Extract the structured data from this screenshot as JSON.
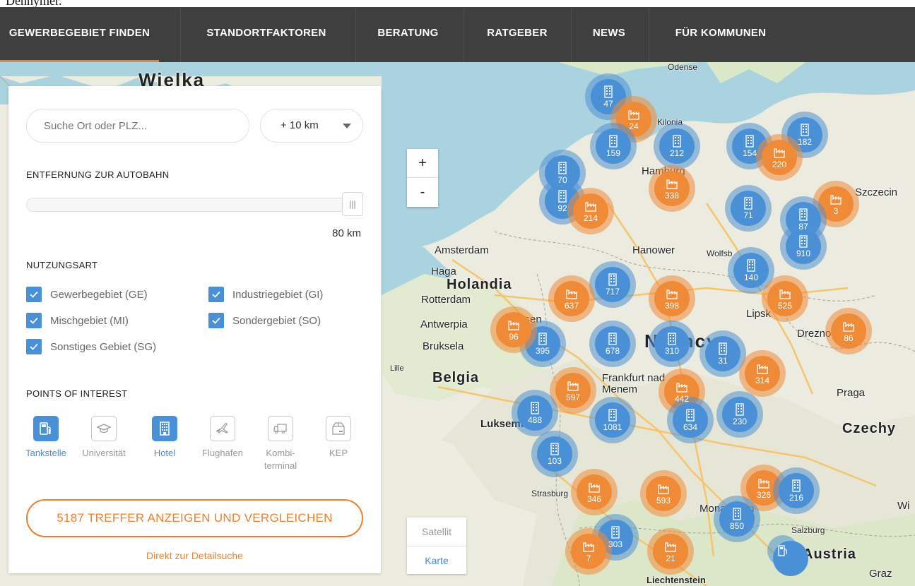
{
  "top_cut_text": "Dennymer.",
  "nav": {
    "items": [
      {
        "label": "GEWERBEGEBIET FINDEN",
        "active": true
      },
      {
        "label": "STANDORTFAKTOREN"
      },
      {
        "label": "BERATUNG"
      },
      {
        "label": "RATGEBER"
      },
      {
        "label": "NEWS"
      },
      {
        "label": "FÜR KOMMUNEN"
      }
    ]
  },
  "panel": {
    "search_placeholder": "Suche Ort oder PLZ...",
    "radius_value": "+ 10 km",
    "autobahn_title": "ENTFERNUNG ZUR AUTOBAHN",
    "slider_handle": "|||",
    "slider_value": "80 km",
    "nutzungsart_title": "NUTZUNGSART",
    "nutzungsart": [
      {
        "label": "Gewerbegebiet (GE)",
        "checked": true
      },
      {
        "label": "Industriegebiet (GI)",
        "checked": true
      },
      {
        "label": "Mischgebiet (MI)",
        "checked": true
      },
      {
        "label": "Sondergebiet (SO)",
        "checked": true
      },
      {
        "label": "Sonstiges Gebiet (SG)",
        "checked": true
      }
    ],
    "poi_title": "POINTS OF INTEREST",
    "poi": [
      {
        "label": "Tankstelle",
        "icon": "fuel-icon",
        "active": true
      },
      {
        "label": "Universität",
        "icon": "graduation-cap-icon",
        "active": false
      },
      {
        "label": "Hotel",
        "icon": "hotel-icon",
        "active": true
      },
      {
        "label": "Flughafen",
        "icon": "airplane-icon",
        "active": false
      },
      {
        "label": "Kombi-terminal",
        "label_line1": "Kombi-",
        "label_line2": "terminal",
        "icon": "truck-icon",
        "active": false
      },
      {
        "label": "KEP",
        "icon": "package-icon",
        "active": false
      }
    ],
    "cta_label": "5187 TREFFER ANZEIGEN UND VERGLEICHEN",
    "detail_link": "Direkt zur Detailsuche"
  },
  "map": {
    "zoom_in": "+",
    "zoom_out": "-",
    "map_type": {
      "satellite": "Satellit",
      "map": "Karte"
    },
    "place_labels": [
      "Wielka",
      "Odense",
      "Kilonia",
      "Szczecin",
      "Amsterdam",
      "Haga",
      "Holandia",
      "Rotterdam",
      "Hanower",
      "Wolfsb",
      "Antwerpia",
      "Essen",
      "Lipsk",
      "Drezno",
      "Bruksela",
      "Lille",
      "Belgia",
      "Frankfurt nad Menem",
      "Praga",
      "Luksemb",
      "Czechy",
      "Strasburg",
      "Monachium",
      "Salzburg",
      "Austria",
      "Wi",
      "Graz",
      "Liechtenstein",
      "Niemcy",
      "Hamburg"
    ],
    "clusters": [
      {
        "count": "47",
        "kind": "hotel"
      },
      {
        "count": "24",
        "kind": "industry"
      },
      {
        "count": "159",
        "kind": "hotel"
      },
      {
        "count": "212",
        "kind": "hotel"
      },
      {
        "count": "154",
        "kind": "hotel"
      },
      {
        "count": "182",
        "kind": "hotel"
      },
      {
        "count": "220",
        "kind": "industry"
      },
      {
        "count": "70",
        "kind": "hotel"
      },
      {
        "count": "338",
        "kind": "industry"
      },
      {
        "count": "92",
        "kind": "hotel"
      },
      {
        "count": "214",
        "kind": "industry"
      },
      {
        "count": "71",
        "kind": "hotel"
      },
      {
        "count": "3",
        "kind": "industry"
      },
      {
        "count": "87",
        "kind": "hotel"
      },
      {
        "count": "910",
        "kind": "hotel"
      },
      {
        "count": "140",
        "kind": "hotel"
      },
      {
        "count": "717",
        "kind": "hotel"
      },
      {
        "count": "637",
        "kind": "industry"
      },
      {
        "count": "398",
        "kind": "industry"
      },
      {
        "count": "525",
        "kind": "industry"
      },
      {
        "count": "395",
        "kind": "hotel"
      },
      {
        "count": "96",
        "kind": "industry"
      },
      {
        "count": "678",
        "kind": "hotel"
      },
      {
        "count": "310",
        "kind": "hotel"
      },
      {
        "count": "31",
        "kind": "hotel"
      },
      {
        "count": "86",
        "kind": "industry"
      },
      {
        "count": "314",
        "kind": "industry"
      },
      {
        "count": "597",
        "kind": "industry"
      },
      {
        "count": "442",
        "kind": "industry"
      },
      {
        "count": "488",
        "kind": "hotel"
      },
      {
        "count": "1081",
        "kind": "hotel"
      },
      {
        "count": "634",
        "kind": "hotel"
      },
      {
        "count": "230",
        "kind": "hotel"
      },
      {
        "count": "103",
        "kind": "hotel"
      },
      {
        "count": "346",
        "kind": "industry"
      },
      {
        "count": "593",
        "kind": "industry"
      },
      {
        "count": "326",
        "kind": "industry"
      },
      {
        "count": "216",
        "kind": "hotel"
      },
      {
        "count": "850",
        "kind": "hotel"
      },
      {
        "count": "303",
        "kind": "hotel"
      },
      {
        "count": "7",
        "kind": "industry"
      },
      {
        "count": "21",
        "kind": "industry"
      },
      {
        "count": "",
        "kind": "fuel"
      }
    ]
  },
  "colors": {
    "accent": "#ee7f2d",
    "blue": "#4a90d6",
    "nav_bg": "#3f3f3f"
  }
}
